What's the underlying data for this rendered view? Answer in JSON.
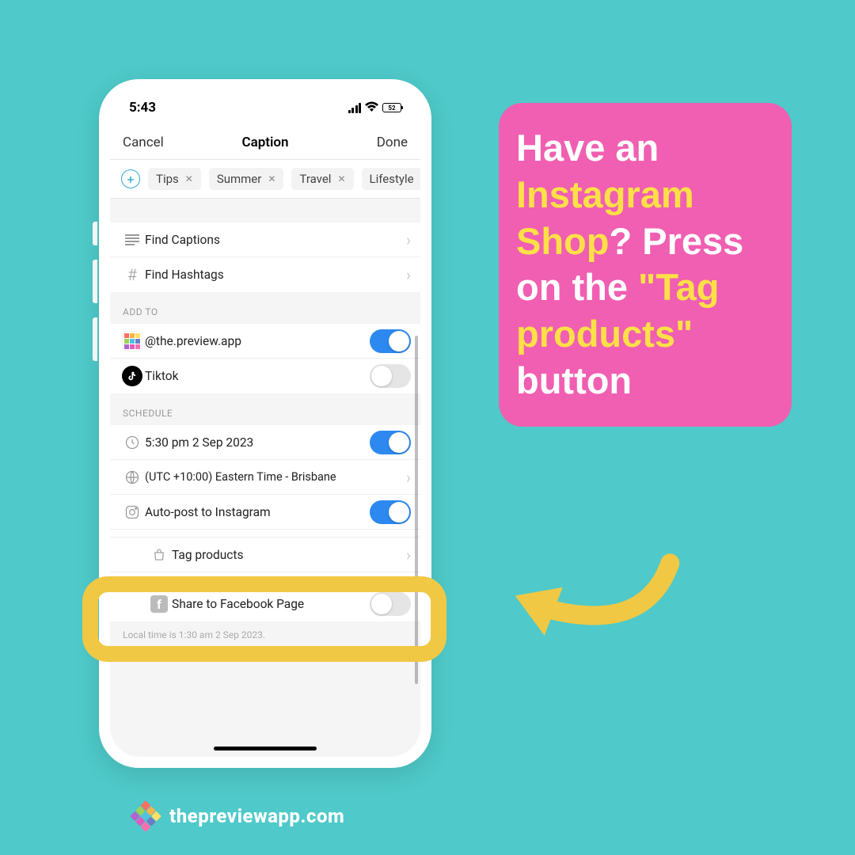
{
  "status": {
    "time": "5:43",
    "battery": "52"
  },
  "nav": {
    "cancel": "Cancel",
    "title": "Caption",
    "done": "Done"
  },
  "tags": [
    "Tips",
    "Summer",
    "Travel",
    "Lifestyle"
  ],
  "rows": {
    "find_captions": "Find Captions",
    "find_hashtags": "Find Hashtags",
    "add_to_header": "ADD TO",
    "preview_account": "@the.preview.app",
    "tiktok": "Tiktok",
    "schedule_header": "SCHEDULE",
    "schedule_time": "5:30 pm  2 Sep 2023",
    "timezone": "(UTC +10:00) Eastern Time - Brisbane",
    "autopost": "Auto-post to Instagram",
    "tag_products": "Tag products",
    "share_fb": "Share to Facebook Page"
  },
  "local_time": "Local time is 1:30 am  2 Sep 2023.",
  "callout": {
    "part1": "Have an ",
    "part2": "Instagram Shop",
    "part3": "? Press on the ",
    "part4": "\"Tag products\"",
    "part5": " button"
  },
  "footer": "thepreviewapp.com"
}
